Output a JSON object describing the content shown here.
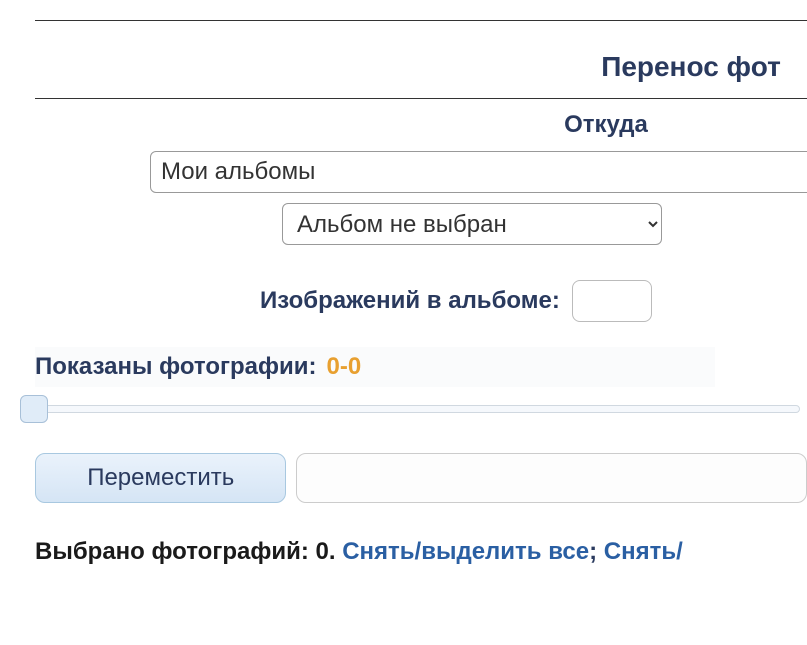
{
  "page": {
    "title": "Перенос фот"
  },
  "source": {
    "label": "Откуда",
    "albums_value": "Мои альбомы",
    "album_select": "Альбом не выбран"
  },
  "images": {
    "count_label": "Изображений в альбоме:",
    "count_value": ""
  },
  "shown": {
    "label": "Показаны фотографии:",
    "range": "0-0"
  },
  "actions": {
    "move_button": "Переместить"
  },
  "selection": {
    "label_prefix": "Выбрано фотографий: ",
    "count": "0",
    "dot": ". ",
    "toggle_all": "Снять/выделить все",
    "separator": "; ",
    "toggle_partial": "Снять/"
  }
}
